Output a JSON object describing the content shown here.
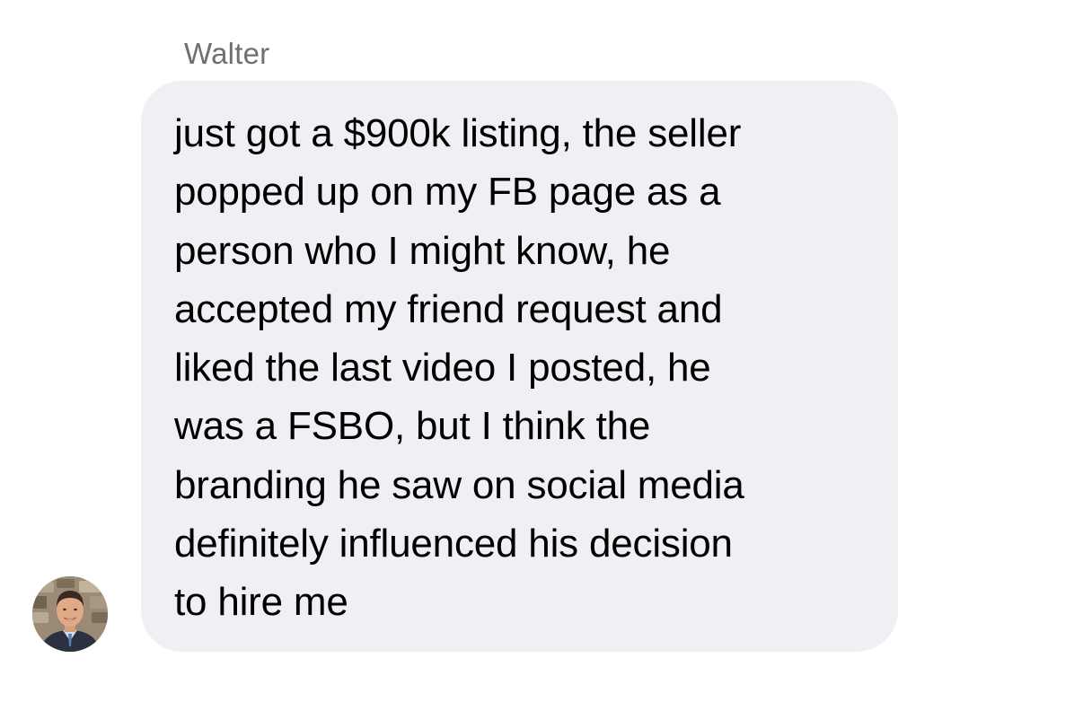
{
  "conversation": {
    "sender_name": "Walter",
    "avatar_icon": "contact-photo-icon",
    "message": {
      "lines": [
        "just got a $900k listing, the seller",
        "popped up on my FB page as a",
        "person who I might know, he",
        "accepted my friend request and",
        "liked the last video I posted, he",
        "was a FSBO, but I think the",
        "branding he saw on social media",
        "definitely influenced his decision",
        "to hire me"
      ]
    }
  },
  "colors": {
    "bubble_background": "#efeff4",
    "sender_name_text": "#6e6e73",
    "message_text": "#000000",
    "page_background": "#ffffff"
  }
}
